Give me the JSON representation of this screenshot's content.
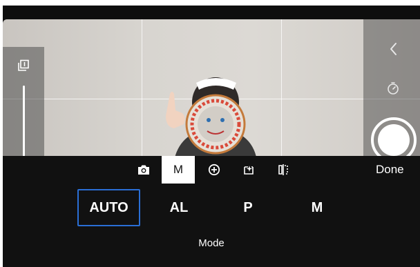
{
  "toolbar": {
    "manual_tab_label": "M",
    "done_label": "Done",
    "icons": [
      "camera-icon",
      "manual-mode-tab",
      "add-circle-icon",
      "sparkle-box-icon",
      "mirror-icon"
    ]
  },
  "modes": {
    "items": [
      {
        "label": "AUTO",
        "selected": true
      },
      {
        "label": "AL",
        "selected": false
      },
      {
        "label": "P",
        "selected": false
      },
      {
        "label": "M",
        "selected": false
      }
    ],
    "caption": "Mode"
  },
  "colors": {
    "selection_border": "#2a6fd6",
    "panel_background": "#111111",
    "text": "#ffffff"
  }
}
